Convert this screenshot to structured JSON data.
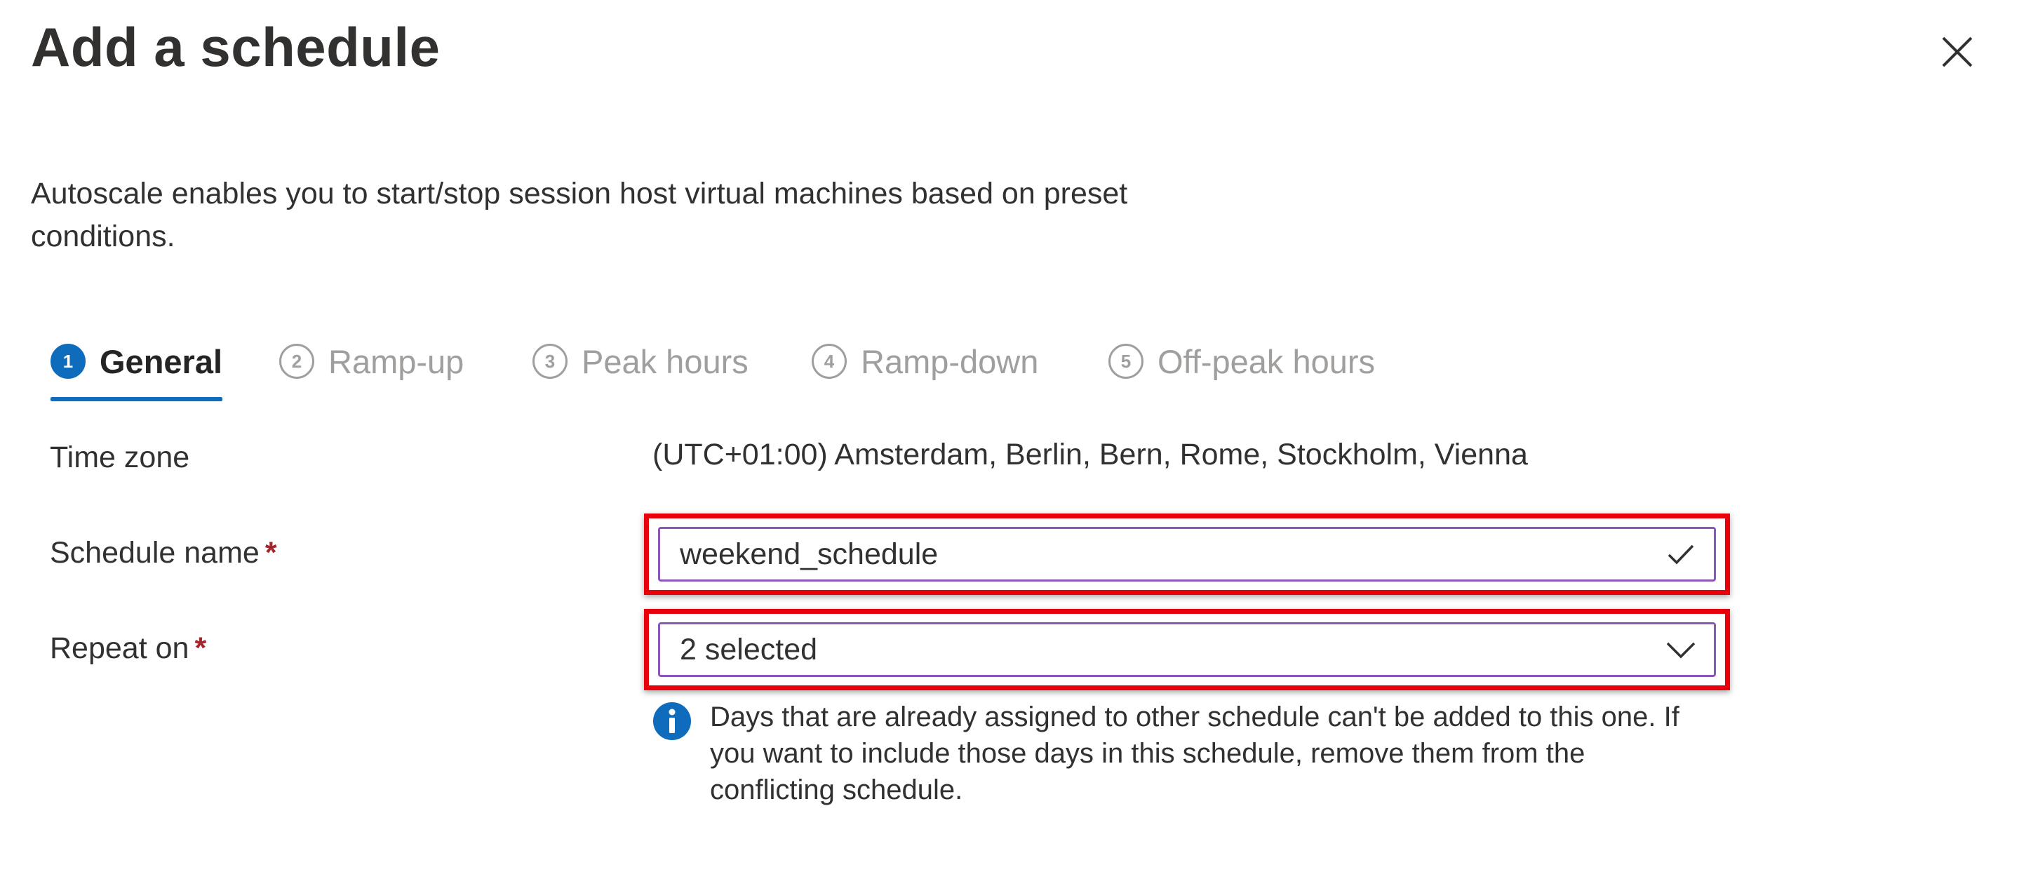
{
  "dialog": {
    "title": "Add a schedule",
    "description": "Autoscale enables you to start/stop session host virtual machines based on preset conditions."
  },
  "steps": [
    {
      "number": "1",
      "label": "General",
      "active": true
    },
    {
      "number": "2",
      "label": "Ramp-up",
      "active": false
    },
    {
      "number": "3",
      "label": "Peak hours",
      "active": false
    },
    {
      "number": "4",
      "label": "Ramp-down",
      "active": false
    },
    {
      "number": "5",
      "label": "Off-peak hours",
      "active": false
    }
  ],
  "form": {
    "time_zone": {
      "label": "Time zone",
      "value": "(UTC+01:00) Amsterdam, Berlin, Bern, Rome, Stockholm, Vienna"
    },
    "schedule_name": {
      "label": "Schedule name",
      "required_mark": "*",
      "value": "weekend_schedule"
    },
    "repeat_on": {
      "label": "Repeat on",
      "required_mark": "*",
      "value": "2 selected"
    },
    "info_message": "Days that are already assigned to other schedule can't be added to this one. If you want to include those days in this schedule, remove them from the conflicting schedule."
  },
  "colors": {
    "accent": "#0f6cbd",
    "highlight_border": "#e8000b",
    "field_border": "#8a56b8",
    "required": "#a4262c",
    "inactive_step": "#a19f9d"
  },
  "icons": {
    "close": "close-icon",
    "valid": "checkmark-icon",
    "dropdown": "chevron-down-icon",
    "info": "info-icon"
  }
}
